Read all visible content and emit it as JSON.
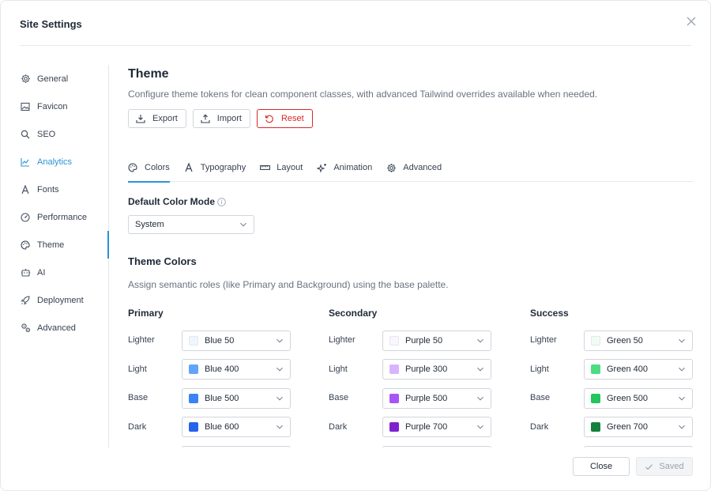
{
  "dialog": {
    "title": "Site Settings"
  },
  "sidebar": {
    "items": [
      {
        "label": "General",
        "icon": "gear-icon"
      },
      {
        "label": "Favicon",
        "icon": "image-icon"
      },
      {
        "label": "SEO",
        "icon": "search-icon"
      },
      {
        "label": "Analytics",
        "icon": "chart-icon"
      },
      {
        "label": "Fonts",
        "icon": "font-icon"
      },
      {
        "label": "Performance",
        "icon": "gauge-icon"
      },
      {
        "label": "Theme",
        "icon": "palette-icon",
        "active": true
      },
      {
        "label": "AI",
        "icon": "robot-icon"
      },
      {
        "label": "Deployment",
        "icon": "rocket-icon"
      },
      {
        "label": "Advanced",
        "icon": "cogs-icon"
      }
    ]
  },
  "main": {
    "title": "Theme",
    "description": "Configure theme tokens for clean component classes, with advanced Tailwind overrides available when needed.",
    "buttons": {
      "export": "Export",
      "import": "Import",
      "reset": "Reset"
    },
    "tabs": [
      {
        "label": "Colors",
        "icon": "palette-icon",
        "active": true
      },
      {
        "label": "Typography",
        "icon": "font-icon"
      },
      {
        "label": "Layout",
        "icon": "ruler-icon"
      },
      {
        "label": "Animation",
        "icon": "sparkles-icon"
      },
      {
        "label": "Advanced",
        "icon": "gear-icon"
      }
    ],
    "color_mode": {
      "label": "Default Color Mode",
      "value": "System"
    },
    "theme_colors": {
      "title": "Theme Colors",
      "description": "Assign semantic roles (like Primary and Background) using the base palette.",
      "row_labels": [
        "Lighter",
        "Light",
        "Base",
        "Dark"
      ],
      "groups": [
        {
          "name": "Primary",
          "values": [
            {
              "label": "Blue 50",
              "color": "#eff6ff"
            },
            {
              "label": "Blue 400",
              "color": "#60a5fa"
            },
            {
              "label": "Blue 500",
              "color": "#3b82f6"
            },
            {
              "label": "Blue 600",
              "color": "#2563eb"
            }
          ]
        },
        {
          "name": "Secondary",
          "values": [
            {
              "label": "Purple 50",
              "color": "#faf5ff"
            },
            {
              "label": "Purple 300",
              "color": "#d8b4fe"
            },
            {
              "label": "Purple 500",
              "color": "#a855f7"
            },
            {
              "label": "Purple 700",
              "color": "#7e22ce"
            }
          ]
        },
        {
          "name": "Success",
          "values": [
            {
              "label": "Green 50",
              "color": "#f0fdf4"
            },
            {
              "label": "Green 400",
              "color": "#4ade80"
            },
            {
              "label": "Green 500",
              "color": "#22c55e"
            },
            {
              "label": "Green 700",
              "color": "#15803d"
            }
          ]
        }
      ]
    }
  },
  "footer": {
    "close": "Close",
    "saved": "Saved"
  },
  "colors": {
    "accent": "#2a94d6",
    "danger": "#dc2626"
  }
}
